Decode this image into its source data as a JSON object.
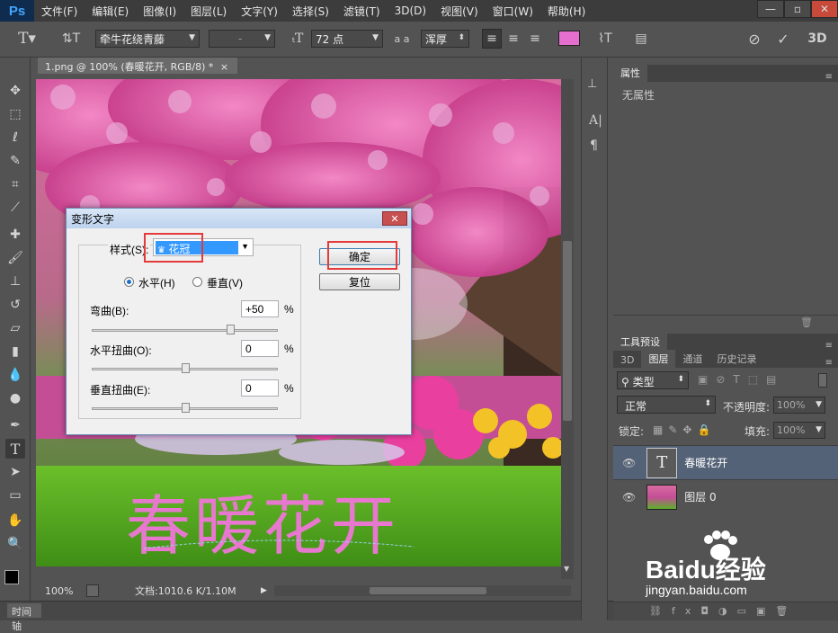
{
  "app": {
    "logo": "Ps"
  },
  "menu": [
    "文件(F)",
    "编辑(E)",
    "图像(I)",
    "图层(L)",
    "文字(Y)",
    "选择(S)",
    "滤镜(T)",
    "3D(D)",
    "视图(V)",
    "窗口(W)",
    "帮助(H)"
  ],
  "window_buttons": [
    "—",
    "▫",
    "✕"
  ],
  "options": {
    "font_family": "牵牛花绕青藤",
    "font_style": "-",
    "font_size": "72 点",
    "aa_label": "a a",
    "anti_alias": "浑厚",
    "mode_3d": "3D",
    "text_color": "#e56fcf"
  },
  "document": {
    "tab_title": "1.png @ 100% (春暖花开, RGB/8) *",
    "zoom": "100%",
    "doc_info": "文档:1010.6 K/1.10M",
    "canvas_text": "春暖花开"
  },
  "timeline": {
    "label": "时间轴"
  },
  "properties": {
    "tab": "属性",
    "empty": "无属性"
  },
  "tool_presets": {
    "tab": "工具预设"
  },
  "layers_panel": {
    "tabs": [
      "3D",
      "图层",
      "通道",
      "历史记录"
    ],
    "filter_kind": "类型",
    "blend_mode": "正常",
    "opacity_label": "不透明度:",
    "opacity_value": "100%",
    "lock_label": "锁定:",
    "fill_label": "填充:",
    "fill_value": "100%",
    "layers": [
      {
        "name": "春暖花开",
        "type": "text",
        "thumb": "T"
      },
      {
        "name": "图层 0",
        "type": "image"
      }
    ]
  },
  "warp_dialog": {
    "title": "变形文字",
    "style_label": "样式(S):",
    "style_value": "花冠",
    "horizontal_label": "水平(H)",
    "vertical_label": "垂直(V)",
    "orientation": "horizontal",
    "bend_label": "弯曲(B):",
    "bend_value": "+50",
    "h_distort_label": "水平扭曲(O):",
    "h_distort_value": "0",
    "v_distort_label": "垂直扭曲(E):",
    "v_distort_value": "0",
    "percent": "%",
    "ok_label": "确定",
    "reset_label": "复位",
    "bend_level": 0.75,
    "h_distort_level": 0.5,
    "v_distort_level": 0.5
  },
  "watermark": {
    "brand": "Baidu经验",
    "url": "jingyan.baidu.com"
  }
}
